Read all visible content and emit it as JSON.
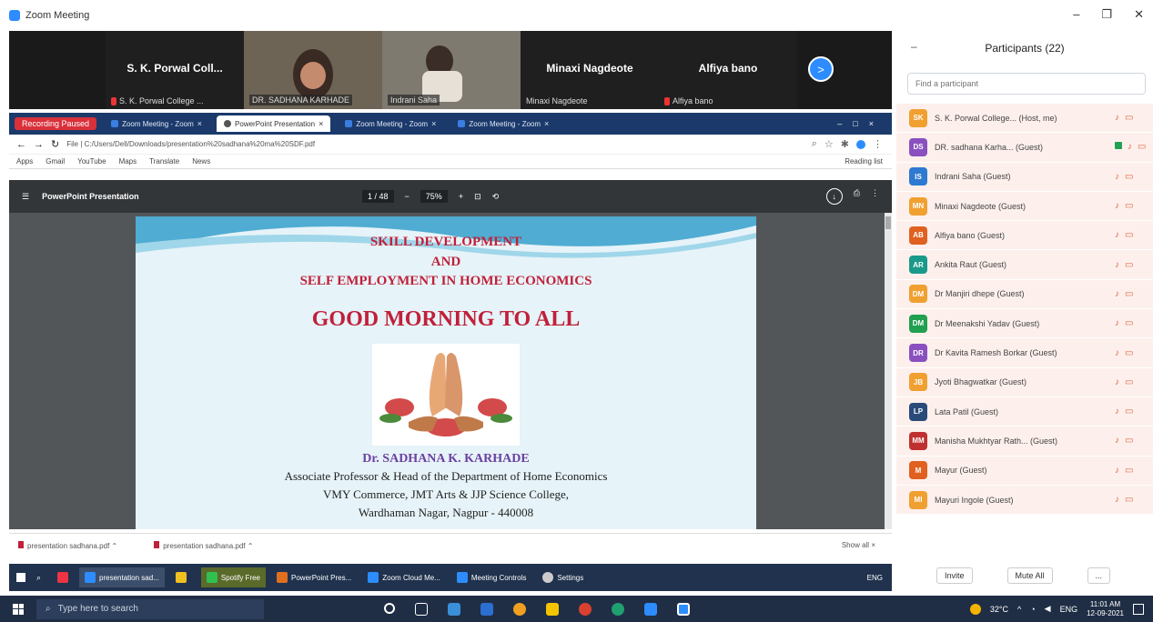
{
  "window": {
    "title": "Zoom Meeting"
  },
  "video_strip": {
    "tiles": [
      {
        "center_name": "S. K. Porwal Coll...",
        "label": "S. K. Porwal College ..."
      },
      {
        "label": "DR. SADHANA KARHADE"
      },
      {
        "label": "Indrani Saha"
      },
      {
        "center_name": "Minaxi Nagdeote",
        "label": "Minaxi Nagdeote"
      },
      {
        "center_name": "Alfiya bano",
        "label": "Alfiya bano"
      }
    ],
    "next_arrow": ">"
  },
  "browser": {
    "recording_status": "Recording Paused",
    "tabs": [
      {
        "label": "Zoom Meeting - Zoom"
      },
      {
        "label": "PowerPoint Presentation"
      },
      {
        "label": "Zoom Meeting - Zoom"
      },
      {
        "label": "Zoom Meeting - Zoom"
      }
    ],
    "url": "File | C:/Users/Dell/Downloads/presentation%20sadhana%20ma%20SDF.pdf",
    "bookmarks": [
      "Apps",
      "Gmail",
      "YouTube",
      "Maps",
      "Translate",
      "News"
    ],
    "reading_list": "Reading list",
    "pdf": {
      "title": "PowerPoint Presentation",
      "page": "1 / 48",
      "zoom": "75%"
    },
    "slide": {
      "line1": "SKILL DEVELOPMENT",
      "line2": "AND",
      "line3": "SELF EMPLOYMENT IN HOME ECONOMICS",
      "greeting": "GOOD MORNING TO  ALL",
      "author": "Dr. SADHANA K. KARHADE",
      "designation": "Associate Professor & Head of the Department of Home Economics",
      "college": "VMY Commerce, JMT Arts & JJP Science College,",
      "address": "Wardhaman Nagar, Nagpur - 440008"
    },
    "downloads": [
      {
        "label": "presentation sadhana.pdf"
      },
      {
        "label": "presentation sadhana.pdf"
      }
    ],
    "show_all": "Show all"
  },
  "shared_taskbar": {
    "items": [
      {
        "label": "presentation sad..."
      },
      {
        "label": ""
      },
      {
        "label": "Spotify Free"
      },
      {
        "label": "PowerPoint Pres..."
      },
      {
        "label": "Zoom Cloud Me..."
      },
      {
        "label": "Meeting Controls"
      },
      {
        "label": "Settings"
      }
    ],
    "tray": "ENG"
  },
  "participants": {
    "title": "Participants (22)",
    "search_placeholder": "Find a participant",
    "list": [
      {
        "initials": "SK",
        "name": "S. K. Porwal College... (Host, me)",
        "color": "#f0a030"
      },
      {
        "initials": "DS",
        "name": "DR. sadhana Karha... (Guest)",
        "color": "#8a50c0"
      },
      {
        "initials": "IS",
        "name": "Indrani Saha (Guest)",
        "color": "#2d7ad0"
      },
      {
        "initials": "MN",
        "name": "Minaxi Nagdeote (Guest)",
        "color": "#f0a030"
      },
      {
        "initials": "AB",
        "name": "Alfiya bano (Guest)",
        "color": "#e06020"
      },
      {
        "initials": "AR",
        "name": "Ankita Raut (Guest)",
        "color": "#1a9a8a"
      },
      {
        "initials": "DM",
        "name": "Dr Manjiri dhepe (Guest)",
        "color": "#f0a030"
      },
      {
        "initials": "DM",
        "name": "Dr Meenakshi Yadav (Guest)",
        "color": "#20a050"
      },
      {
        "initials": "DR",
        "name": "Dr Kavita Ramesh Borkar (Guest)",
        "color": "#8a50c0"
      },
      {
        "initials": "JB",
        "name": "Jyoti Bhagwatkar (Guest)",
        "color": "#f0a030"
      },
      {
        "initials": "LP",
        "name": "Lata Patil (Guest)",
        "color": "#2a4a7a"
      },
      {
        "initials": "MM",
        "name": "Manisha Mukhtyar Rath... (Guest)",
        "color": "#c03030"
      },
      {
        "initials": "M",
        "name": "Mayur (Guest)",
        "color": "#e06020"
      },
      {
        "initials": "MI",
        "name": "Mayuri Ingole (Guest)",
        "color": "#f0a030"
      }
    ],
    "invite": "Invite",
    "mute_all": "Mute All",
    "more": "..."
  },
  "taskbar": {
    "search_placeholder": "Type here to search",
    "weather": "32°C",
    "lang": "ENG",
    "time": "11:01 AM",
    "date": "12-09-2021"
  }
}
